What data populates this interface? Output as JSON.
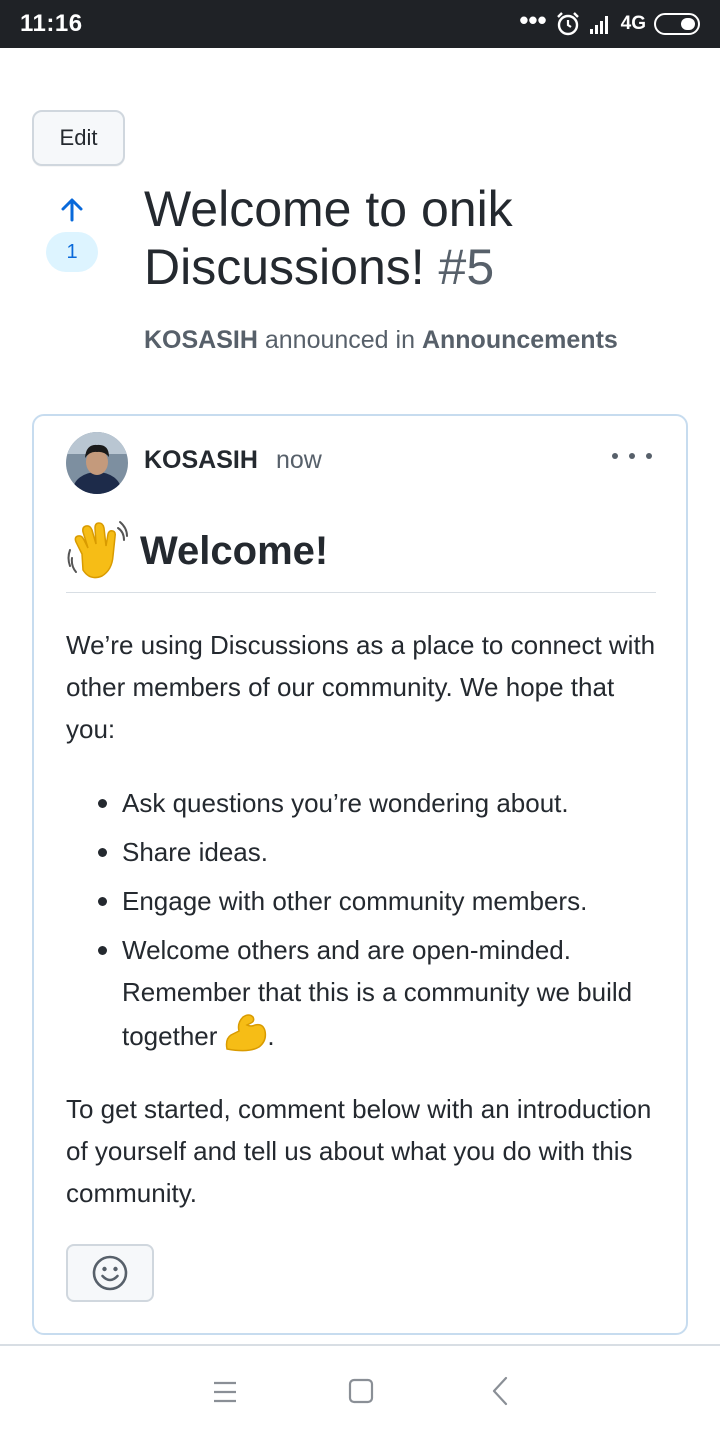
{
  "status_bar": {
    "time": "11:16",
    "network": "4G",
    "icons": [
      "more-dots-icon",
      "alarm-icon",
      "signal-icon",
      "battery-icon"
    ]
  },
  "edit_button": {
    "label": "Edit"
  },
  "upvote": {
    "count": "1",
    "icon": "arrow-up-icon",
    "color": "#0969da"
  },
  "discussion": {
    "title": "Welcome to onik Discussions!",
    "number": "#5",
    "author": "KOSASIH",
    "action": "announced in",
    "category": "Announcements"
  },
  "post": {
    "author": "KOSASIH",
    "timestamp": "now",
    "heading_icon": "waving-hand-icon",
    "heading": "Welcome!",
    "intro": "We’re using Discussions as a place to connect with other members of our community. We hope that you:",
    "bullets": [
      "Ask questions you’re wondering about.",
      "Share ideas.",
      "Engage with other community members.",
      "Welcome others and are open-minded. Remember that this is a community we build together"
    ],
    "bullet_end_icon": "flexed-biceps-icon",
    "bullet_end_text": ".",
    "outro": "To get started, comment below with an introduction of yourself and tell us about what you do with this community.",
    "reaction_icon": "smiley-icon"
  },
  "nav_bar": {
    "icons": [
      "menu-icon",
      "home-icon",
      "back-icon"
    ]
  },
  "colors": {
    "accent": "#0969da",
    "card_border": "#c7dcef",
    "status_bar": "#1f2226"
  }
}
